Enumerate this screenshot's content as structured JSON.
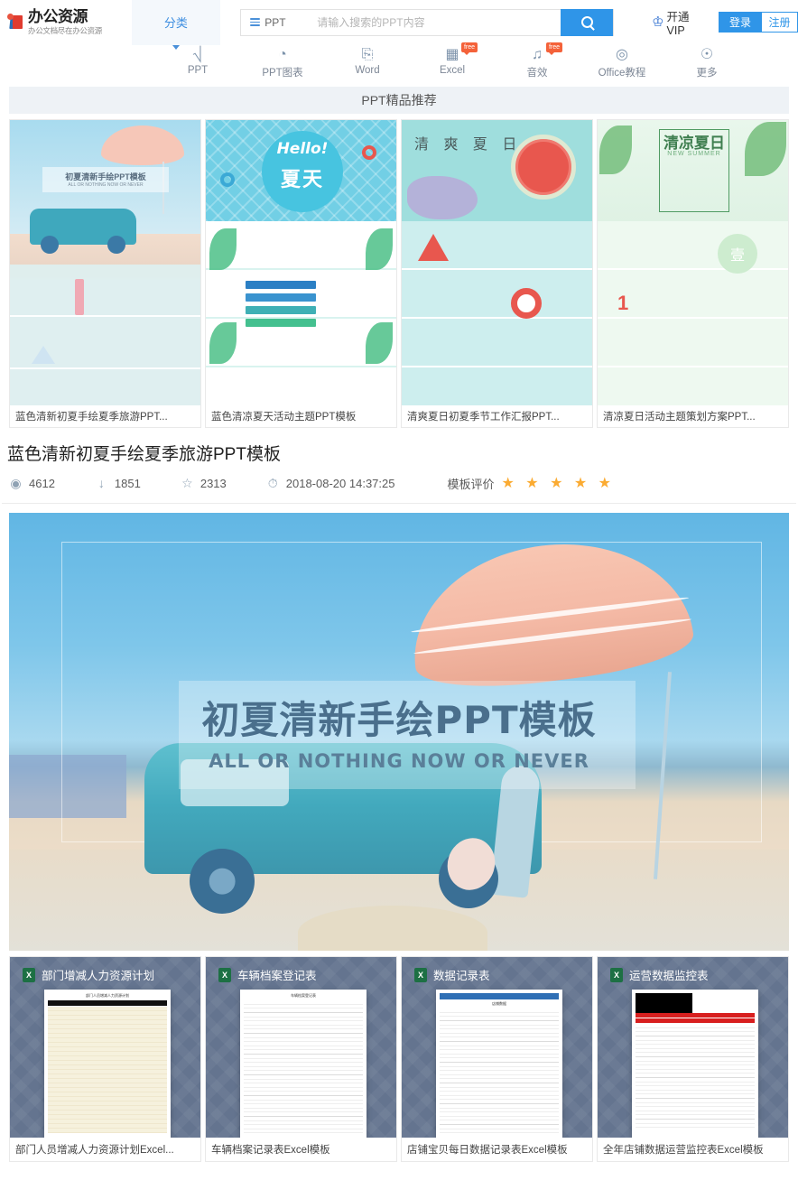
{
  "header": {
    "logo_title": "办公资源",
    "logo_sub": "办公文档尽在办公资源",
    "category_label": "分类",
    "search": {
      "type_label": "PPT",
      "placeholder": "请输入搜索的PPT内容",
      "value": "",
      "button_icon": "search-icon"
    },
    "vip_label": "开通VIP",
    "login_label": "登录",
    "register_label": "注册"
  },
  "nav": {
    "items": [
      {
        "label": "PPT",
        "icon": "ppt-screen-icon",
        "glyph": "⎕",
        "badge": ""
      },
      {
        "label": "PPT图表",
        "icon": "pie-chart-icon",
        "glyph": "◔",
        "badge": ""
      },
      {
        "label": "Word",
        "icon": "word-doc-icon",
        "glyph": "὜E",
        "badge": ""
      },
      {
        "label": "Excel",
        "icon": "excel-grid-icon",
        "glyph": "▦",
        "badge": "free"
      },
      {
        "label": "音效",
        "icon": "music-note-icon",
        "glyph": "♫",
        "badge": "free"
      },
      {
        "label": "Office教程",
        "icon": "play-circle-icon",
        "glyph": "▶",
        "badge": ""
      },
      {
        "label": "更多",
        "icon": "more-dots-icon",
        "glyph": "⋯",
        "badge": ""
      }
    ]
  },
  "section": {
    "recommend_title": "PPT精品推荐"
  },
  "recommended": [
    {
      "caption": "蓝色清新初夏手绘夏季旅游PPT...",
      "thumb_title": "初夏清新手绘PPT模板",
      "thumb_subtitle": "ALL OR NOTHING NOW OR NEVER"
    },
    {
      "caption": "蓝色清凉夏天活动主题PPT模板",
      "thumb_title": "Hello!",
      "thumb_subtitle": "夏天"
    },
    {
      "caption": "清爽夏日初夏季节工作汇报PPT...",
      "thumb_title": "清 爽 夏 日",
      "thumb_subtitle": ""
    },
    {
      "caption": "清凉夏日活动主题策划方案PPT...",
      "thumb_title": "清凉夏日",
      "thumb_subtitle": "NEW SUMMER"
    }
  ],
  "detail": {
    "title": "蓝色清新初夏手绘夏季旅游PPT模板",
    "stats": [
      {
        "icon": "eye-icon",
        "glyph": "◉",
        "value": "4612"
      },
      {
        "icon": "download-arrow-icon",
        "glyph": "↓",
        "value": "1851"
      },
      {
        "icon": "star-outline-icon",
        "glyph": "☆",
        "value": "2313"
      },
      {
        "icon": "clock-icon",
        "glyph": "◴",
        "value": "2018-08-20 14:37:25"
      }
    ],
    "rating_label": "模板评价",
    "rating_stars": "★ ★ ★ ★ ★",
    "rating_value": 5,
    "star_color": "#fbab32"
  },
  "preview": {
    "title": "初夏清新手绘PPT模板",
    "subtitle": "ALL OR NOTHING NOW OR NEVER"
  },
  "excel_cards": [
    {
      "header": "部门增减人力资源计划",
      "caption": "部门人员增减人力资源计划Excel...",
      "icon": "excel-file-icon",
      "icon_glyph": "X",
      "sheet_title": "部门人员增减人力资源计划",
      "sheet_style": "cream"
    },
    {
      "header": "车辆档案登记表",
      "caption": "车辆档案记录表Excel模板",
      "icon": "excel-file-icon",
      "icon_glyph": "X",
      "sheet_title": "车辆档案登记表",
      "sheet_style": "plain"
    },
    {
      "header": "数据记录表",
      "caption": "店铺宝贝每日数据记录表Excel模板",
      "icon": "excel-file-icon",
      "icon_glyph": "X",
      "sheet_title": "店铺数据",
      "sheet_style": "blue"
    },
    {
      "header": "运营数据监控表",
      "caption": "全年店铺数据运营监控表Excel模板",
      "icon": "excel-file-icon",
      "icon_glyph": "X",
      "sheet_title": "运营数据监控表",
      "sheet_style": "dark"
    }
  ],
  "colors": {
    "accent_blue": "#2f95e8",
    "badge_orange": "#f4623a",
    "star_orange": "#fbab32",
    "section_bg": "#eef2f6",
    "excel_green": "#1d7044",
    "excel_card_bg": "#64748f"
  }
}
